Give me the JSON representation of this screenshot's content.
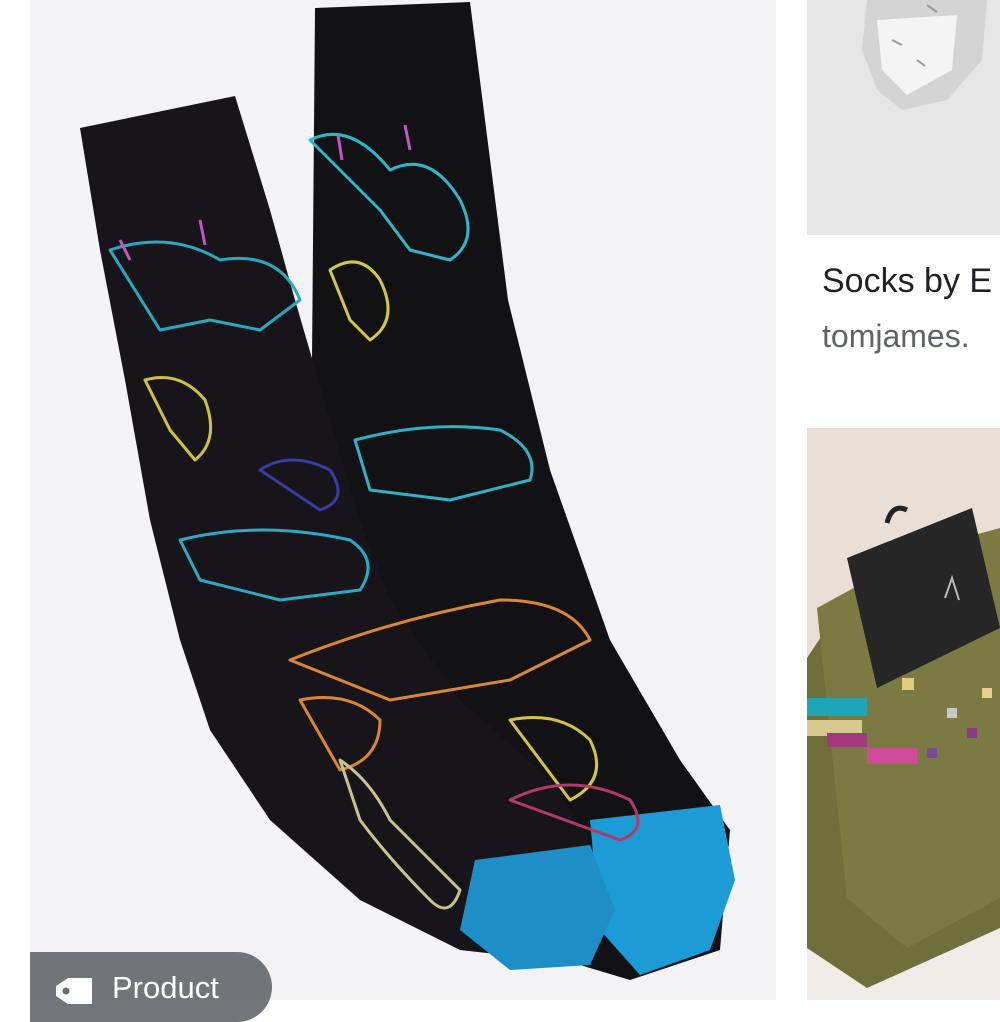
{
  "main_result": {
    "badge_label": "Product",
    "badge_icon": "tag-icon"
  },
  "side_result": {
    "title": "Socks by E",
    "source": "tomjames."
  },
  "colors": {
    "chip_bg": "#5f6368",
    "sock_black": "#121114",
    "sock_toe": "#1d9bd6"
  }
}
